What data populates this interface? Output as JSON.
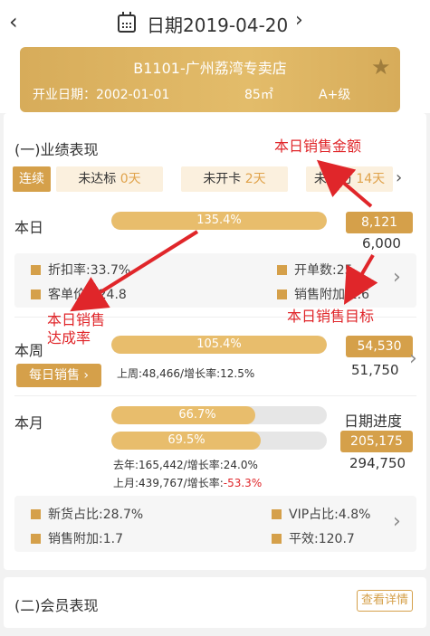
{
  "header": {
    "back_icon": "chevron-left-icon",
    "calendar_icon": "calendar-icon",
    "title": "日期2019-04-20",
    "next_icon": "chevron-right-icon"
  },
  "store": {
    "name": "B1101-广州荔湾专卖店",
    "open_date": "开业日期：2002-01-01",
    "area": "85㎡",
    "level": "A+级",
    "star_icon": "star-icon"
  },
  "section1": {
    "title": "(一)业绩表现"
  },
  "tabs": {
    "continuous": "连续",
    "items": [
      {
        "label": "未达标",
        "value": "0天"
      },
      {
        "label": "未开卡",
        "value": "2天"
      },
      {
        "label": "未回访",
        "value": "14天"
      }
    ]
  },
  "today": {
    "label": "本日",
    "bar_text": "135.4%",
    "progress": 1.354,
    "amount": "8,121",
    "target": "6,000",
    "kpis": [
      "折扣率:33.7%",
      "开单数:25",
      "客单价:324.8",
      "销售附加:1.6"
    ]
  },
  "week": {
    "label": "本周",
    "bar_text": "105.4%",
    "progress": 1.054,
    "amount": "54,530",
    "target": "51,750",
    "sub": "上周:48,466/增长率:12.5%",
    "daily_btn": "每日销售"
  },
  "month": {
    "label": "本月",
    "bar1_text": "66.7%",
    "progress1": 0.667,
    "bar2_text": "69.5%",
    "progress2": 0.695,
    "date_progress_label": "日期进度",
    "amount": "205,175",
    "target": "294,750",
    "sub1": "去年:165,442/增长率:24.0%",
    "sub2_prefix": "上月:439,767/增长率:",
    "sub2_value": "-53.3%",
    "kpis": [
      "新货占比:28.7%",
      "VIP占比:4.8%",
      "销售附加:1.7",
      "平效:120.7"
    ]
  },
  "section2": {
    "title": "(二)会员表现",
    "detail_btn": "查看详情"
  },
  "annotations": {
    "a1": "本日销售金额",
    "a2": "本日销售",
    "a2b": "达成率",
    "a3": "本日销售目标"
  },
  "colors": {
    "gold": "#d5a04a",
    "bar": "#e8bd6c",
    "annotation": "#e0262a"
  }
}
